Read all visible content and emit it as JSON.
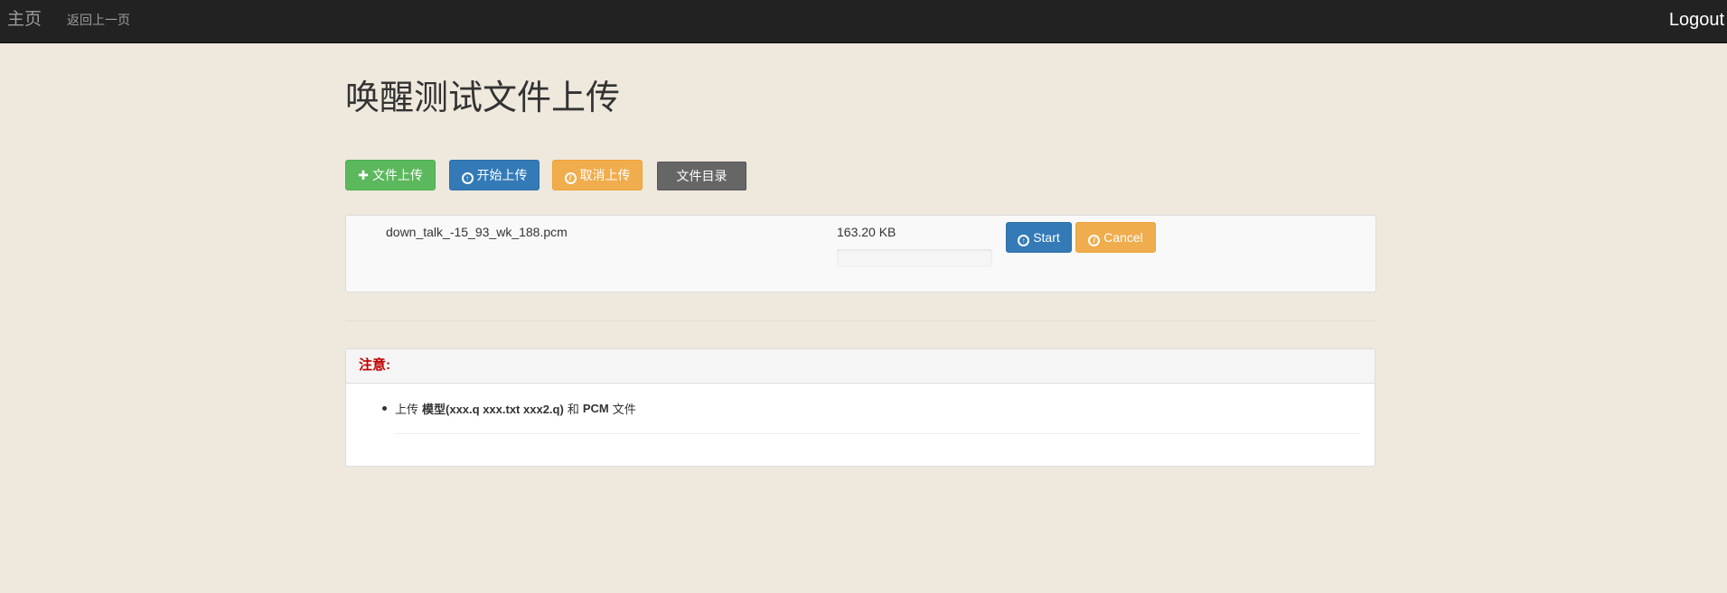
{
  "navbar": {
    "brand": "主页",
    "back": "返回上一页",
    "logout": "Logout"
  },
  "page": {
    "title": "唤醒测试文件上传"
  },
  "toolbar": {
    "add_files": "文件上传",
    "start_upload": "开始上传",
    "cancel_upload": "取消上传",
    "file_directory": "文件目录"
  },
  "file_row": {
    "name": "down_talk_-15_93_wk_188.pcm",
    "size": "163.20 KB",
    "progress_percent": 0,
    "start_label": "Start",
    "cancel_label": "Cancel"
  },
  "note": {
    "heading": "注意:",
    "item_prefix": "上传",
    "item_bold_1": "模型(xxx.q xxx.txt xxx2.q)",
    "item_mid": "和",
    "item_bold_2": "PCM",
    "item_suffix": "文件"
  },
  "colors": {
    "navbar_bg": "#222222",
    "page_bg": "#eee8dd",
    "success": "#5cb85c",
    "primary": "#337ab7",
    "warning": "#f0ad4e",
    "dark": "#666666",
    "note_heading": "#c00000"
  },
  "icons": {
    "add_files": "plus-icon",
    "start_upload": "upload-circle-icon",
    "cancel_upload": "ban-icon"
  }
}
